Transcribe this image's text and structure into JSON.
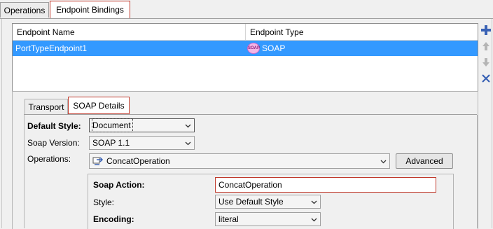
{
  "tabs": {
    "operations": "Operations",
    "endpoint_bindings": "Endpoint Bindings"
  },
  "table": {
    "columns": [
      "Endpoint Name",
      "Endpoint Type"
    ],
    "rows": [
      {
        "name": "PortTypeEndpoint1",
        "type": "SOAP",
        "type_icon": "soap-icon",
        "selected": true
      }
    ]
  },
  "side_buttons": [
    "add-icon",
    "move-up-icon",
    "move-down-icon",
    "delete-icon"
  ],
  "detail_tabs": {
    "transport": "Transport",
    "soap_details": "SOAP Details"
  },
  "form": {
    "default_style_label": "Default Style:",
    "default_style_value": "Document",
    "soap_version_label": "Soap Version:",
    "soap_version_value": "SOAP 1.1",
    "operations_label": "Operations:",
    "operations_value": "ConcatOperation",
    "advanced_button": "Advanced"
  },
  "operation_details": {
    "soap_action_label": "Soap Action:",
    "soap_action_value": "ConcatOperation",
    "style_label": "Style:",
    "style_value": "Use Default Style",
    "encoding_label": "Encoding:",
    "encoding_value": "literal"
  },
  "colors": {
    "selection": "#3399ff",
    "highlight_border": "#c0392b",
    "add": "#3a62b5"
  }
}
